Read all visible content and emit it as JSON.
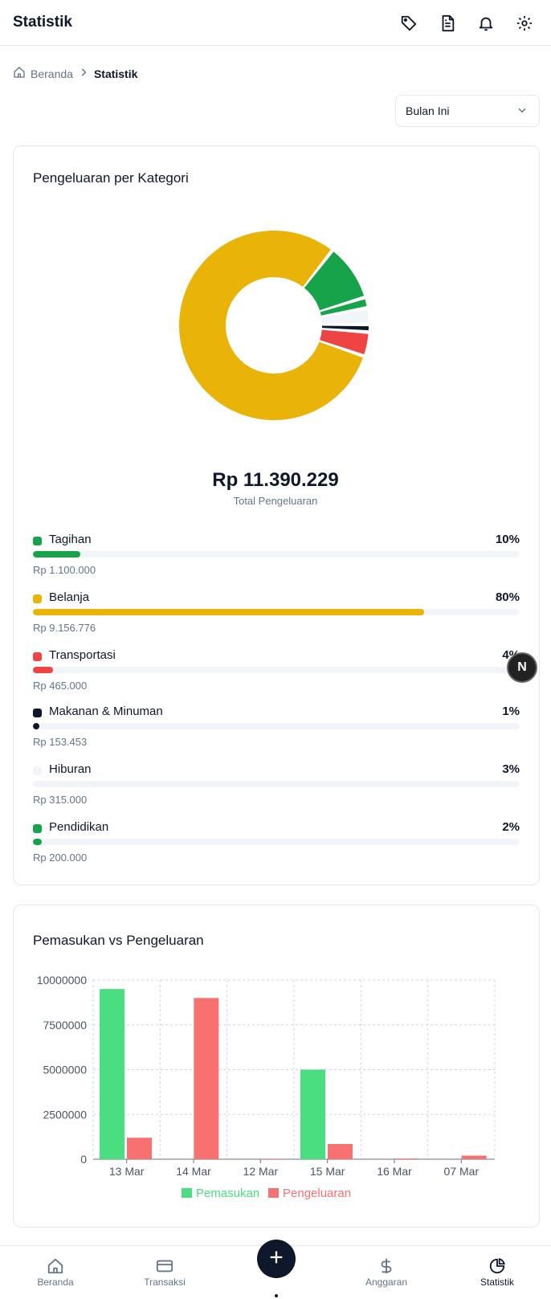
{
  "header": {
    "title": "Statistik"
  },
  "breadcrumb": {
    "home": "Beranda",
    "current": "Statistik"
  },
  "period_select": {
    "value": "Bulan Ini"
  },
  "category_card": {
    "title": "Pengeluaran per Kategori",
    "total": "Rp 11.390.229",
    "total_label": "Total Pengeluaran",
    "categories": [
      {
        "name": "Tagihan",
        "percent": "10%",
        "amount": "Rp 1.100.000",
        "color": "#16a34a",
        "fill": 0.097
      },
      {
        "name": "Belanja",
        "percent": "80%",
        "amount": "Rp 9.156.776",
        "color": "#eab308",
        "fill": 0.804
      },
      {
        "name": "Transportasi",
        "percent": "4%",
        "amount": "Rp 465.000",
        "color": "#ef4444",
        "fill": 0.041
      },
      {
        "name": "Makanan & Minuman",
        "percent": "1%",
        "amount": "Rp 153.453",
        "color": "#0f172a",
        "fill": 0.013
      },
      {
        "name": "Hiburan",
        "percent": "3%",
        "amount": "Rp 315.000",
        "color": "#f1f5f9",
        "fill": 0.028
      },
      {
        "name": "Pendidikan",
        "percent": "2%",
        "amount": "Rp 200.000",
        "color": "#16a34a",
        "fill": 0.018
      }
    ]
  },
  "chart_data": {
    "type": "bar",
    "title": "Pemasukan vs Pengeluaran",
    "categories": [
      "13 Mar",
      "14 Mar",
      "12 Mar",
      "15 Mar",
      "16 Mar",
      "07 Mar"
    ],
    "series": [
      {
        "name": "Pemasukan",
        "color": "#4ade80",
        "values": [
          9500000,
          0,
          0,
          5000000,
          0,
          0
        ]
      },
      {
        "name": "Pengeluaran",
        "color": "#f87171",
        "values": [
          1200000,
          9000000,
          30000,
          850000,
          40000,
          200000
        ]
      }
    ],
    "ylim": [
      0,
      10000000
    ],
    "yticks": [
      "10000000",
      "7500000",
      "5000000",
      "2500000",
      "0"
    ],
    "grid": true,
    "legend": "bottom"
  },
  "nbadge": "N",
  "bottom_nav": [
    {
      "label": "Beranda",
      "icon": "home-icon"
    },
    {
      "label": "Transaksi",
      "icon": "card-icon"
    },
    {
      "label": "Anggaran",
      "icon": "dollar-icon"
    },
    {
      "label": "Statistik",
      "icon": "pie-icon"
    }
  ]
}
